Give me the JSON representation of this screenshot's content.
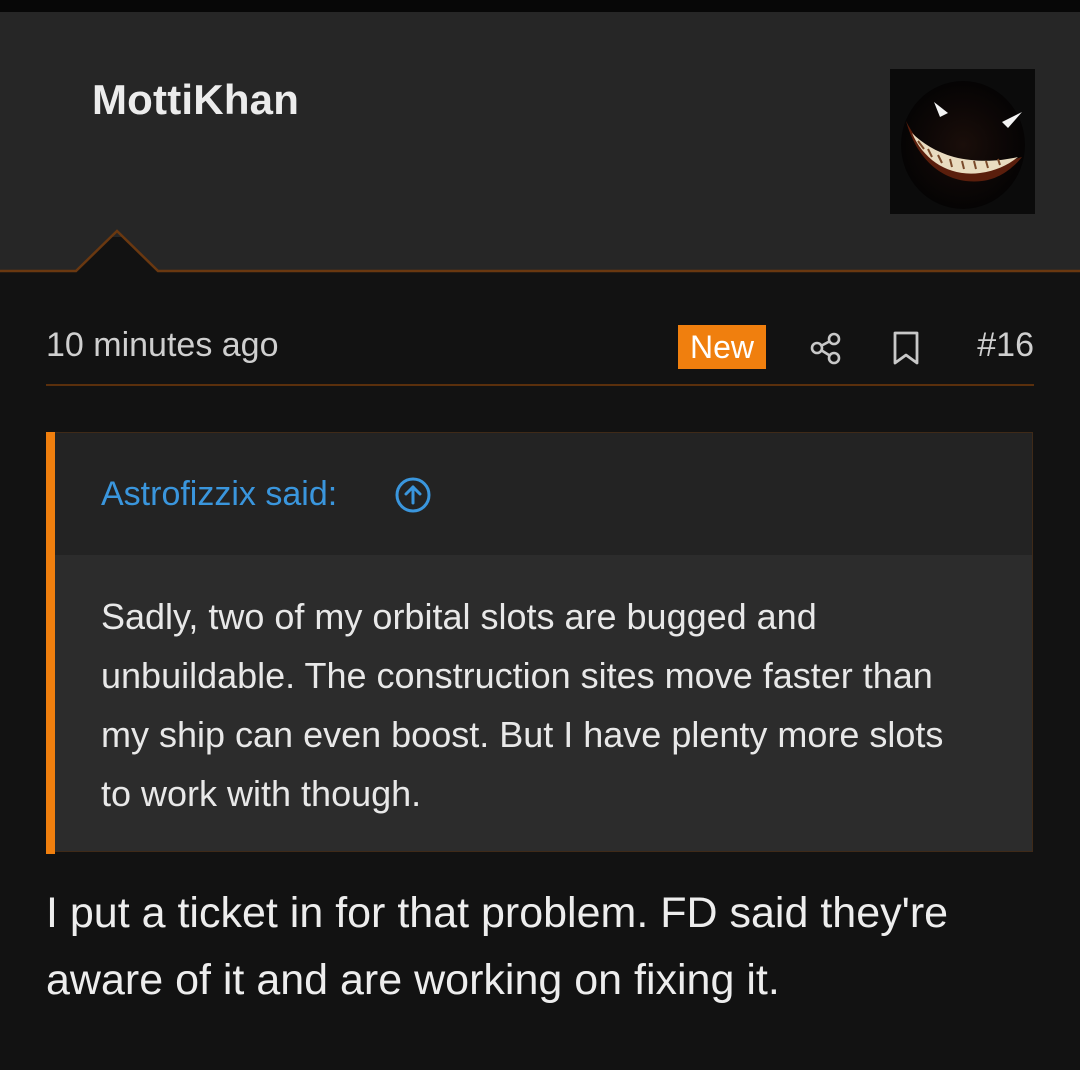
{
  "post": {
    "username": "MottiKhan",
    "time_ago": "10 minutes ago",
    "badge": "New",
    "post_number": "#16",
    "icons": {
      "share": "share-icon",
      "bookmark": "bookmark-icon",
      "quote_jump": "arrow-up-circle-icon"
    },
    "quote": {
      "author_label": "Astrofizzix said:",
      "text": "Sadly, two of my orbital slots are bugged and unbuildable. The construction sites move faster than my ship can even boost. But I have plenty more slots to work with though."
    },
    "reply": "I put a ticket in for that problem. FD said they're aware of it and are working on fixing it."
  },
  "colors": {
    "accent": "#f07f0e",
    "link": "#3a96dd",
    "header_bg": "#262626",
    "page_bg": "#121212",
    "quote_bg": "#2c2c2c"
  }
}
